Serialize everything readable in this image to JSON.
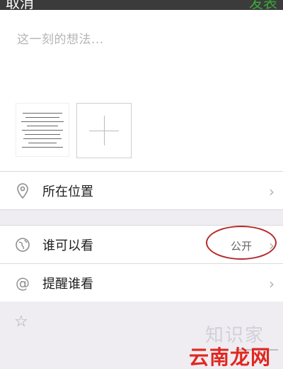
{
  "header": {
    "cancel_label": "取消",
    "send_label": "发表"
  },
  "composer": {
    "placeholder": "这一刻的想法..."
  },
  "rows": {
    "location": {
      "label": "所在位置"
    },
    "visibility": {
      "label": "谁可以看",
      "value": "公开"
    },
    "remind": {
      "label": "提醒谁看"
    }
  },
  "watermarks": {
    "zhishijia": "知识家",
    "site": "云南龙网"
  },
  "icons": {
    "location": "location-pin-icon",
    "globe": "globe-icon",
    "at": "at-sign-icon",
    "star": "star-icon",
    "chevron": "chevron-right-icon",
    "add": "plus-icon"
  },
  "colors": {
    "send_green": "#3aa83a",
    "highlight_red": "#b42a2a",
    "watermark_red": "#e0271f"
  }
}
